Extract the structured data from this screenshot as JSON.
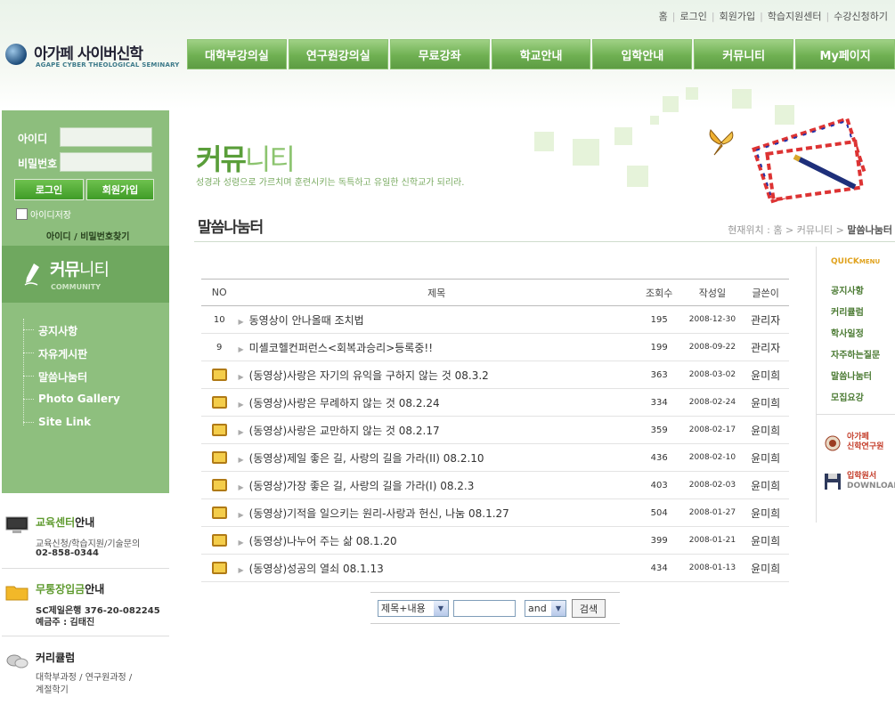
{
  "header": {
    "util_links": [
      "홈",
      "로그인",
      "회원가입",
      "학습지원센터",
      "수강신청하기"
    ],
    "logo_name": "아가페 사이버신학",
    "logo_sub": "AGAPE CYBER THEOLOGICAL SEMINARY",
    "gnb": [
      "대학부강의실",
      "연구원강의실",
      "무료강좌",
      "학교안내",
      "입학안내",
      "커뮤니티",
      "My페이지"
    ]
  },
  "login": {
    "id_label": "아이디",
    "pw_label": "비밀번호",
    "login_button": "로그인",
    "join_button": "회원가입",
    "save_id": "아이디저장",
    "find": "아이디 / 비밀번호찾기"
  },
  "leftnav": {
    "title_bold": "커뮤",
    "title_rest": "니티",
    "sub": "COMMUNITY",
    "items": [
      "공지사항",
      "자유게시판",
      "말씀나눔터",
      "Photo Gallery",
      "Site Link"
    ]
  },
  "info": {
    "edu_title_b": "교육센터",
    "edu_title_r": "안내",
    "edu_line1": "교육신청/학습지원/기술문의",
    "edu_line2": "02-858-0344",
    "bank_title_b": "무통장입금",
    "bank_title_r": "안내",
    "bank_line1": "SC제일은행 376-20-082245",
    "bank_line2": "예금주 : 김태진",
    "cur_title": "커리큘럼",
    "cur_line1": "대학부과정 / 연구원과정 /",
    "cur_line2": "계절학기"
  },
  "title": {
    "big_bold": "커뮤",
    "big_rest": "니티",
    "slogan": "성경과 성령으로 가르치며 훈련시키는 독특하고 유일한 신학교가 되리라.",
    "page_title": "말씀나눔터",
    "location_prefix": "현재위치 : 홈 > 커뮤니티 >",
    "location_current": "말씀나눔터"
  },
  "board": {
    "headers": [
      "NO",
      "제목",
      "조회수",
      "작성일",
      "글쓴이"
    ],
    "rows": [
      {
        "no": "10",
        "video": false,
        "subject": "동영상이 안나올때 조치법",
        "hits": "195",
        "date": "2008-12-30",
        "writer": "관리자"
      },
      {
        "no": "9",
        "video": false,
        "subject": "미셸코헬컨퍼런스<회복과승리>등록중!!",
        "hits": "199",
        "date": "2008-09-22",
        "writer": "관리자"
      },
      {
        "no": "",
        "video": true,
        "subject": "(동영상)사랑은 자기의 유익을 구하지 않는 것 08.3.2",
        "hits": "363",
        "date": "2008-03-02",
        "writer": "윤미희"
      },
      {
        "no": "",
        "video": true,
        "subject": "(동영상)사랑은 무례하지 않는 것 08.2.24",
        "hits": "334",
        "date": "2008-02-24",
        "writer": "윤미희"
      },
      {
        "no": "",
        "video": true,
        "subject": "(동영상)사랑은 교만하지 않는 것 08.2.17",
        "hits": "359",
        "date": "2008-02-17",
        "writer": "윤미희"
      },
      {
        "no": "",
        "video": true,
        "subject": "(동영상)제일 좋은 길, 사랑의 길을 가라(II) 08.2.10",
        "hits": "436",
        "date": "2008-02-10",
        "writer": "윤미희"
      },
      {
        "no": "",
        "video": true,
        "subject": "(동영상)가장 좋은 길, 사랑의 길을 가라(I) 08.2.3",
        "hits": "403",
        "date": "2008-02-03",
        "writer": "윤미희"
      },
      {
        "no": "",
        "video": true,
        "subject": "(동영상)기적을 일으키는 원리-사랑과 헌신, 나눔 08.1.27",
        "hits": "504",
        "date": "2008-01-27",
        "writer": "윤미희"
      },
      {
        "no": "",
        "video": true,
        "subject": "(동영상)나누어 주는 삶 08.1.20",
        "hits": "399",
        "date": "2008-01-21",
        "writer": "윤미희"
      },
      {
        "no": "",
        "video": true,
        "subject": "(동영상)성공의 열쇠 08.1.13",
        "hits": "434",
        "date": "2008-01-13",
        "writer": "윤미희"
      }
    ]
  },
  "search": {
    "field_select": "제목+내용",
    "op_select": "and",
    "button": "검색"
  },
  "quick": {
    "head_a": "QUICK",
    "head_b": "MENU",
    "items": [
      "공지사항",
      "커리큘럼",
      "학사일정",
      "자주하는질문",
      "말씀나눔터",
      "모집요강"
    ],
    "banner1_a": "아가페",
    "banner1_b": "신학연구원",
    "banner2_a": "입학원서",
    "banner2_b": "DOWNLOAD"
  },
  "colors": {
    "brand_green": "#6fb052",
    "accent_orange": "#e0a21d",
    "accent_red": "#c43d2a"
  }
}
